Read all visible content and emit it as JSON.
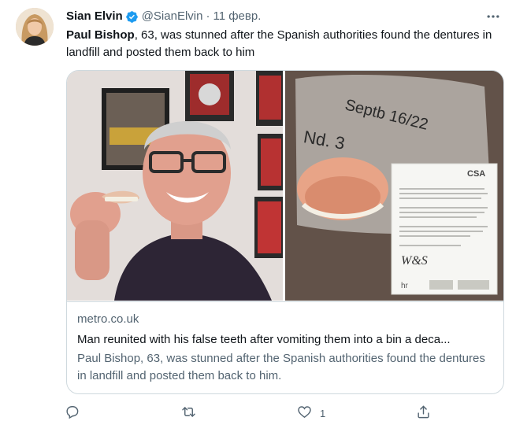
{
  "tweet": {
    "author_name": "Sian Elvin",
    "verified": true,
    "handle": "@SianElvin",
    "separator": "·",
    "date": "11 февр.",
    "text_lead": "Paul Bishop",
    "text_rest": ", 63, was stunned after the Spanish authorities found the dentures in landfill and posted them back to him"
  },
  "card": {
    "domain": "metro.co.uk",
    "title": "Man reunited with his false teeth after vomiting them into a bin a deca...",
    "description": "Paul Bishop, 63, was stunned after the Spanish authorities found the dentures in landfill and posted them back to him.",
    "handwriting": "Septb 16/22\nNd. 3",
    "letter_logo": "CSA",
    "signature": "W&S",
    "letter_footer": "hr"
  },
  "actions": {
    "reply_count": "",
    "retweet_count": "",
    "like_count": "1",
    "share_count": ""
  },
  "colors": {
    "text": "#0f1419",
    "secondary": "#536471",
    "border": "#cfd9de",
    "verified": "#1d9bf0"
  }
}
